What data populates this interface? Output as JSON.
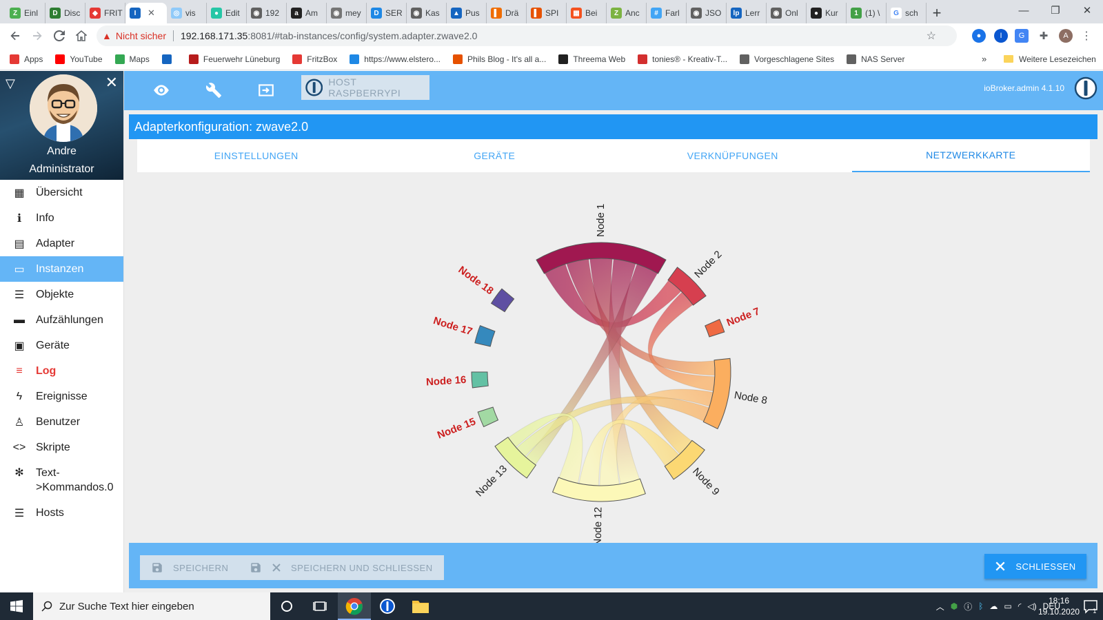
{
  "browser": {
    "tabs": [
      {
        "label": "Einl",
        "color": "#4caf50",
        "glyph": "Z"
      },
      {
        "label": "Disc",
        "color": "#2e7d32",
        "glyph": "D"
      },
      {
        "label": "FRIT",
        "color": "#e53935",
        "glyph": "◆"
      },
      {
        "label": "",
        "color": "#1565c0",
        "glyph": "I",
        "active": true
      },
      {
        "label": "vis",
        "color": "#90caf9",
        "glyph": "◎"
      },
      {
        "label": "Edit",
        "color": "#26c6a6",
        "glyph": "●"
      },
      {
        "label": "192",
        "color": "#616161",
        "glyph": "◉"
      },
      {
        "label": "Am",
        "color": "#222222",
        "glyph": "a"
      },
      {
        "label": "mey",
        "color": "#757575",
        "glyph": "◉"
      },
      {
        "label": "SER",
        "color": "#1e88e5",
        "glyph": "D"
      },
      {
        "label": "Kas",
        "color": "#616161",
        "glyph": "◉"
      },
      {
        "label": "Pus",
        "color": "#1565c0",
        "glyph": "▲"
      },
      {
        "label": "Drä",
        "color": "#ef6c00",
        "glyph": "▌"
      },
      {
        "label": "SPI",
        "color": "#e65100",
        "glyph": "▌"
      },
      {
        "label": "Bei",
        "color": "#f4511e",
        "glyph": "▦"
      },
      {
        "label": "Anc",
        "color": "#7cb342",
        "glyph": "Z"
      },
      {
        "label": "Farl",
        "color": "#42a5f5",
        "glyph": "#"
      },
      {
        "label": "JSO",
        "color": "#616161",
        "glyph": "◉"
      },
      {
        "label": "Lerr",
        "color": "#1565c0",
        "glyph": "lp"
      },
      {
        "label": "Onl",
        "color": "#616161",
        "glyph": "◉"
      },
      {
        "label": "Kur",
        "color": "#212121",
        "glyph": "●"
      },
      {
        "label": "(1) \\",
        "color": "#43a047",
        "glyph": "1"
      },
      {
        "label": "sch",
        "color": "#ffffff",
        "glyph": "G"
      }
    ],
    "close_tab": "✕",
    "new_tab": "+",
    "window_controls": {
      "minimize": "—",
      "maximize": "❐",
      "close": "✕"
    },
    "insecure_label": "Nicht sicher",
    "url_host": "192.168.171.35",
    "url_rest": ":8081/#tab-instances/config/system.adapter.zwave2.0",
    "bookmarks": [
      {
        "label": "Apps",
        "color": "#e53935"
      },
      {
        "label": "YouTube",
        "color": "#ff0000"
      },
      {
        "label": "Maps",
        "color": "#34a853"
      },
      {
        "label": "",
        "color": "#1565c0"
      },
      {
        "label": "Feuerwehr Lüneburg",
        "color": "#b71c1c"
      },
      {
        "label": "FritzBox",
        "color": "#e53935"
      },
      {
        "label": "https://www.elstero...",
        "color": "#1e88e5"
      },
      {
        "label": "Phils Blog - It's all a...",
        "color": "#e65100"
      },
      {
        "label": "Threema Web",
        "color": "#212121"
      },
      {
        "label": "tonies® - Kreativ-T...",
        "color": "#d32f2f"
      },
      {
        "label": "Vorgeschlagene Sites",
        "color": "#616161"
      },
      {
        "label": "NAS Server",
        "color": "#616161"
      }
    ],
    "more_bookmarks": "»",
    "other_bookmarks": "Weitere Lesezeichen"
  },
  "sidebar": {
    "user_name": "Andre",
    "user_role": "Administrator",
    "items": [
      {
        "label": "Übersicht",
        "icon": "grid-icon",
        "glyph": "▦"
      },
      {
        "label": "Info",
        "icon": "info-icon",
        "glyph": "ℹ"
      },
      {
        "label": "Adapter",
        "icon": "store-icon",
        "glyph": "▤"
      },
      {
        "label": "Instanzen",
        "icon": "instances-icon",
        "glyph": "▭",
        "active": true
      },
      {
        "label": "Objekte",
        "icon": "list-icon",
        "glyph": "☰"
      },
      {
        "label": "Aufzählungen",
        "icon": "enum-icon",
        "glyph": "▬"
      },
      {
        "label": "Geräte",
        "icon": "devices-icon",
        "glyph": "▣"
      },
      {
        "label": "Log",
        "icon": "log-icon",
        "glyph": "≡",
        "log": true
      },
      {
        "label": "Ereignisse",
        "icon": "bolt-icon",
        "glyph": "ϟ"
      },
      {
        "label": "Benutzer",
        "icon": "user-icon",
        "glyph": "♙"
      },
      {
        "label": "Skripte",
        "icon": "code-icon",
        "glyph": "<>"
      },
      {
        "label": "Text->Kommandos.0",
        "icon": "snowflake-icon",
        "glyph": "✻",
        "multi": true
      },
      {
        "label": "Hosts",
        "icon": "hosts-icon",
        "glyph": "☰"
      }
    ]
  },
  "appbar": {
    "host_label": "HOST RASPBERRYPI",
    "version": "ioBroker.admin 4.1.10"
  },
  "config": {
    "title": "Adapterkonfiguration: zwave2.0",
    "tabs": [
      "EINSTELLUNGEN",
      "GERÄTE",
      "VERKNÜPFUNGEN",
      "NETZWERKKARTE"
    ],
    "active_tab": 3
  },
  "chart_data": {
    "type": "chord",
    "nodes": [
      {
        "name": "Node 1",
        "color": "#a01850",
        "label_color": "#222222",
        "bold": false
      },
      {
        "name": "Node 2",
        "color": "#d63f4f",
        "label_color": "#222222",
        "bold": false
      },
      {
        "name": "Node 7",
        "color": "#ef6a43",
        "label_color": "#cc1f1f",
        "bold": true
      },
      {
        "name": "Node 8",
        "color": "#fbae5f",
        "label_color": "#222222",
        "bold": false
      },
      {
        "name": "Node 9",
        "color": "#fcd873",
        "label_color": "#222222",
        "bold": false
      },
      {
        "name": "Node 12",
        "color": "#fcf8b8",
        "label_color": "#222222",
        "bold": false
      },
      {
        "name": "Node 13",
        "color": "#e6f49c",
        "label_color": "#222222",
        "bold": false
      },
      {
        "name": "Node 15",
        "color": "#a2d9a3",
        "label_color": "#cc1f1f",
        "bold": true
      },
      {
        "name": "Node 16",
        "color": "#63c1a4",
        "label_color": "#cc1f1f",
        "bold": true
      },
      {
        "name": "Node 17",
        "color": "#3589bd",
        "label_color": "#cc1f1f",
        "bold": true
      },
      {
        "name": "Node 18",
        "color": "#5e4fa2",
        "label_color": "#cc1f1f",
        "bold": true
      }
    ],
    "links": [
      {
        "source": "Node 1",
        "target": "Node 2"
      },
      {
        "source": "Node 1",
        "target": "Node 8"
      },
      {
        "source": "Node 1",
        "target": "Node 9"
      },
      {
        "source": "Node 1",
        "target": "Node 12"
      },
      {
        "source": "Node 1",
        "target": "Node 13"
      },
      {
        "source": "Node 2",
        "target": "Node 8"
      },
      {
        "source": "Node 8",
        "target": "Node 12"
      },
      {
        "source": "Node 8",
        "target": "Node 13"
      },
      {
        "source": "Node 9",
        "target": "Node 12"
      },
      {
        "source": "Node 12",
        "target": "Node 13"
      }
    ]
  },
  "footer": {
    "save": "SPEICHERN",
    "save_close": "SPEICHERN UND SCHLIESSEN",
    "close": "SCHLIESSEN"
  },
  "taskbar": {
    "search_placeholder": "Zur Suche Text hier eingeben",
    "language": "DEU",
    "time": "18:16",
    "date": "19.10.2020",
    "notification_count": "1"
  }
}
